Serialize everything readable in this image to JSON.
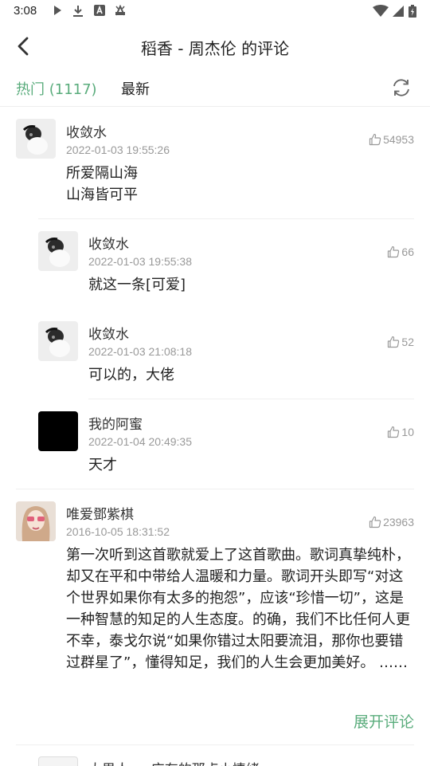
{
  "status_bar": {
    "time": "3:08",
    "icons": [
      "play-icon",
      "download-icon",
      "a-box-icon",
      "android-icon",
      "wifi-icon",
      "signal-icon",
      "battery-icon"
    ]
  },
  "header": {
    "title": "稻香 - 周杰伦 的评论"
  },
  "tabs": {
    "hot": "热门 (1117)",
    "latest": "最新",
    "active": "hot",
    "accent": "#5aac7c"
  },
  "comments": [
    {
      "user": "收敛水",
      "time": "2022-01-03 19:55:26",
      "likes": "54953",
      "text": "所爱隔山海\n山海皆可平",
      "replies": [
        {
          "user": "收敛水",
          "time": "2022-01-03 19:55:38",
          "likes": "66",
          "text": "就这一条[可爱]"
        },
        {
          "user": "收敛水",
          "time": "2022-01-03 21:08:18",
          "likes": "52",
          "text": "可以的，大佬"
        },
        {
          "user": "我的阿蜜",
          "time": "2022-01-04 20:49:35",
          "likes": "10",
          "text": "天才"
        }
      ]
    },
    {
      "user": "唯爱鄧紫棋",
      "time": "2016-10-05 18:31:52",
      "likes": "23963",
      "text": "第一次听到这首歌就爱上了这首歌曲。歌词真挚纯朴，却又在平和中带给人温暖和力量。歌词开头即写“对这个世界如果你有太多的抱怨”，应该“珍惜一切”，这是一种智慧的知足的人生态度。的确，我们不比任何人更不幸，泰戈尔说“如果你错过太阳要流泪，那你也要错过群星了”，懂得知足，我们的人生会更加美好。 ……",
      "expand_label": "展开评论"
    }
  ],
  "next_comment_partial": {
    "user": "大男人 ～ 应有的那点小情绪"
  }
}
